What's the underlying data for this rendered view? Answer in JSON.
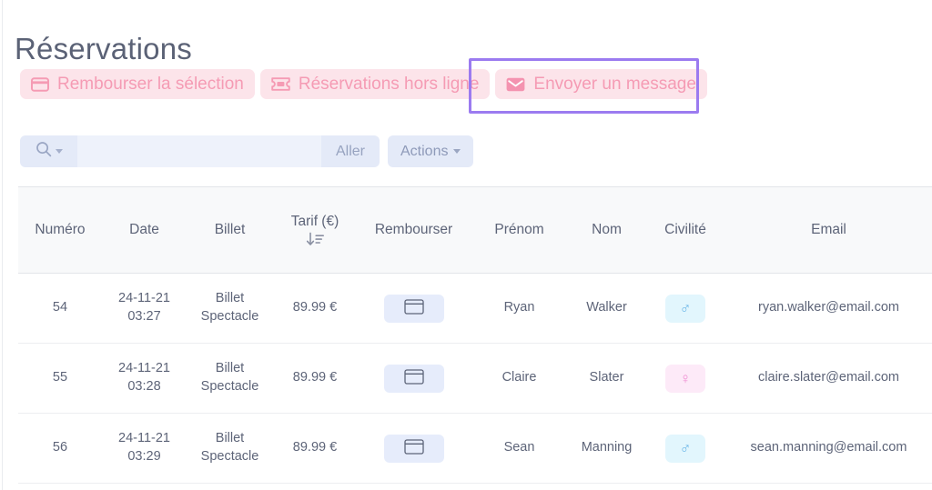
{
  "page": {
    "title": "Réservations"
  },
  "actions_bar": {
    "buttons": [
      {
        "label": "Rembourser la sélection",
        "icon": "credit-card-icon",
        "name": "refund-selection-button"
      },
      {
        "label": "Réservations hors ligne",
        "icon": "ticket-icon",
        "name": "offline-reservations-button"
      },
      {
        "label": "Envoyer un message",
        "icon": "envelope-icon",
        "name": "send-message-button"
      }
    ],
    "highlighted_button": "Envoyer un message",
    "highlight_color": "#9b7bf0",
    "button_bg": "#fce4ea",
    "button_text_color": "#f59bb4"
  },
  "toolbar": {
    "search_value": "",
    "search_placeholder": "",
    "search_icon": "magnifier-icon",
    "go_label": "Aller",
    "actions_label": "Actions"
  },
  "table": {
    "columns": [
      {
        "key": "numero",
        "label": "Numéro"
      },
      {
        "key": "date",
        "label": "Date"
      },
      {
        "key": "billet",
        "label": "Billet"
      },
      {
        "key": "tarif",
        "label": "Tarif (€)",
        "sorted": "desc",
        "sort_icon": "sort-descending-icon"
      },
      {
        "key": "rembourser",
        "label": "Rembourser"
      },
      {
        "key": "prenom",
        "label": "Prénom"
      },
      {
        "key": "nom",
        "label": "Nom"
      },
      {
        "key": "civilite",
        "label": "Civilité"
      },
      {
        "key": "email",
        "label": "Email"
      }
    ],
    "rows": [
      {
        "numero": "54",
        "date": "24-11-21 03:27",
        "billet": "Billet Spectacle",
        "tarif": "89.99 €",
        "rembourser_icon": "credit-card-icon",
        "prenom": "Ryan",
        "nom": "Walker",
        "civilite": "♂",
        "civilite_kind": "male",
        "email": "ryan.walker@email.com"
      },
      {
        "numero": "55",
        "date": "24-11-21 03:28",
        "billet": "Billet Spectacle",
        "tarif": "89.99 €",
        "rembourser_icon": "credit-card-icon",
        "prenom": "Claire",
        "nom": "Slater",
        "civilite": "♀",
        "civilite_kind": "female",
        "email": "claire.slater@email.com"
      },
      {
        "numero": "56",
        "date": "24-11-21 03:29",
        "billet": "Billet Spectacle",
        "tarif": "89.99 €",
        "rembourser_icon": "credit-card-icon",
        "prenom": "Sean",
        "nom": "Manning",
        "civilite": "♂",
        "civilite_kind": "male",
        "email": "sean.manning@email.com"
      }
    ]
  },
  "colors": {
    "text": "#5d6478",
    "header_bg": "#f8f9fa",
    "toolbar_bg": "#e4eaf8",
    "input_bg": "#eef2fb",
    "male_badge_bg": "#e2f6fd",
    "male_badge_fg": "#6cb7e8",
    "female_badge_bg": "#fdeaf8",
    "female_badge_fg": "#ef8fd3"
  }
}
